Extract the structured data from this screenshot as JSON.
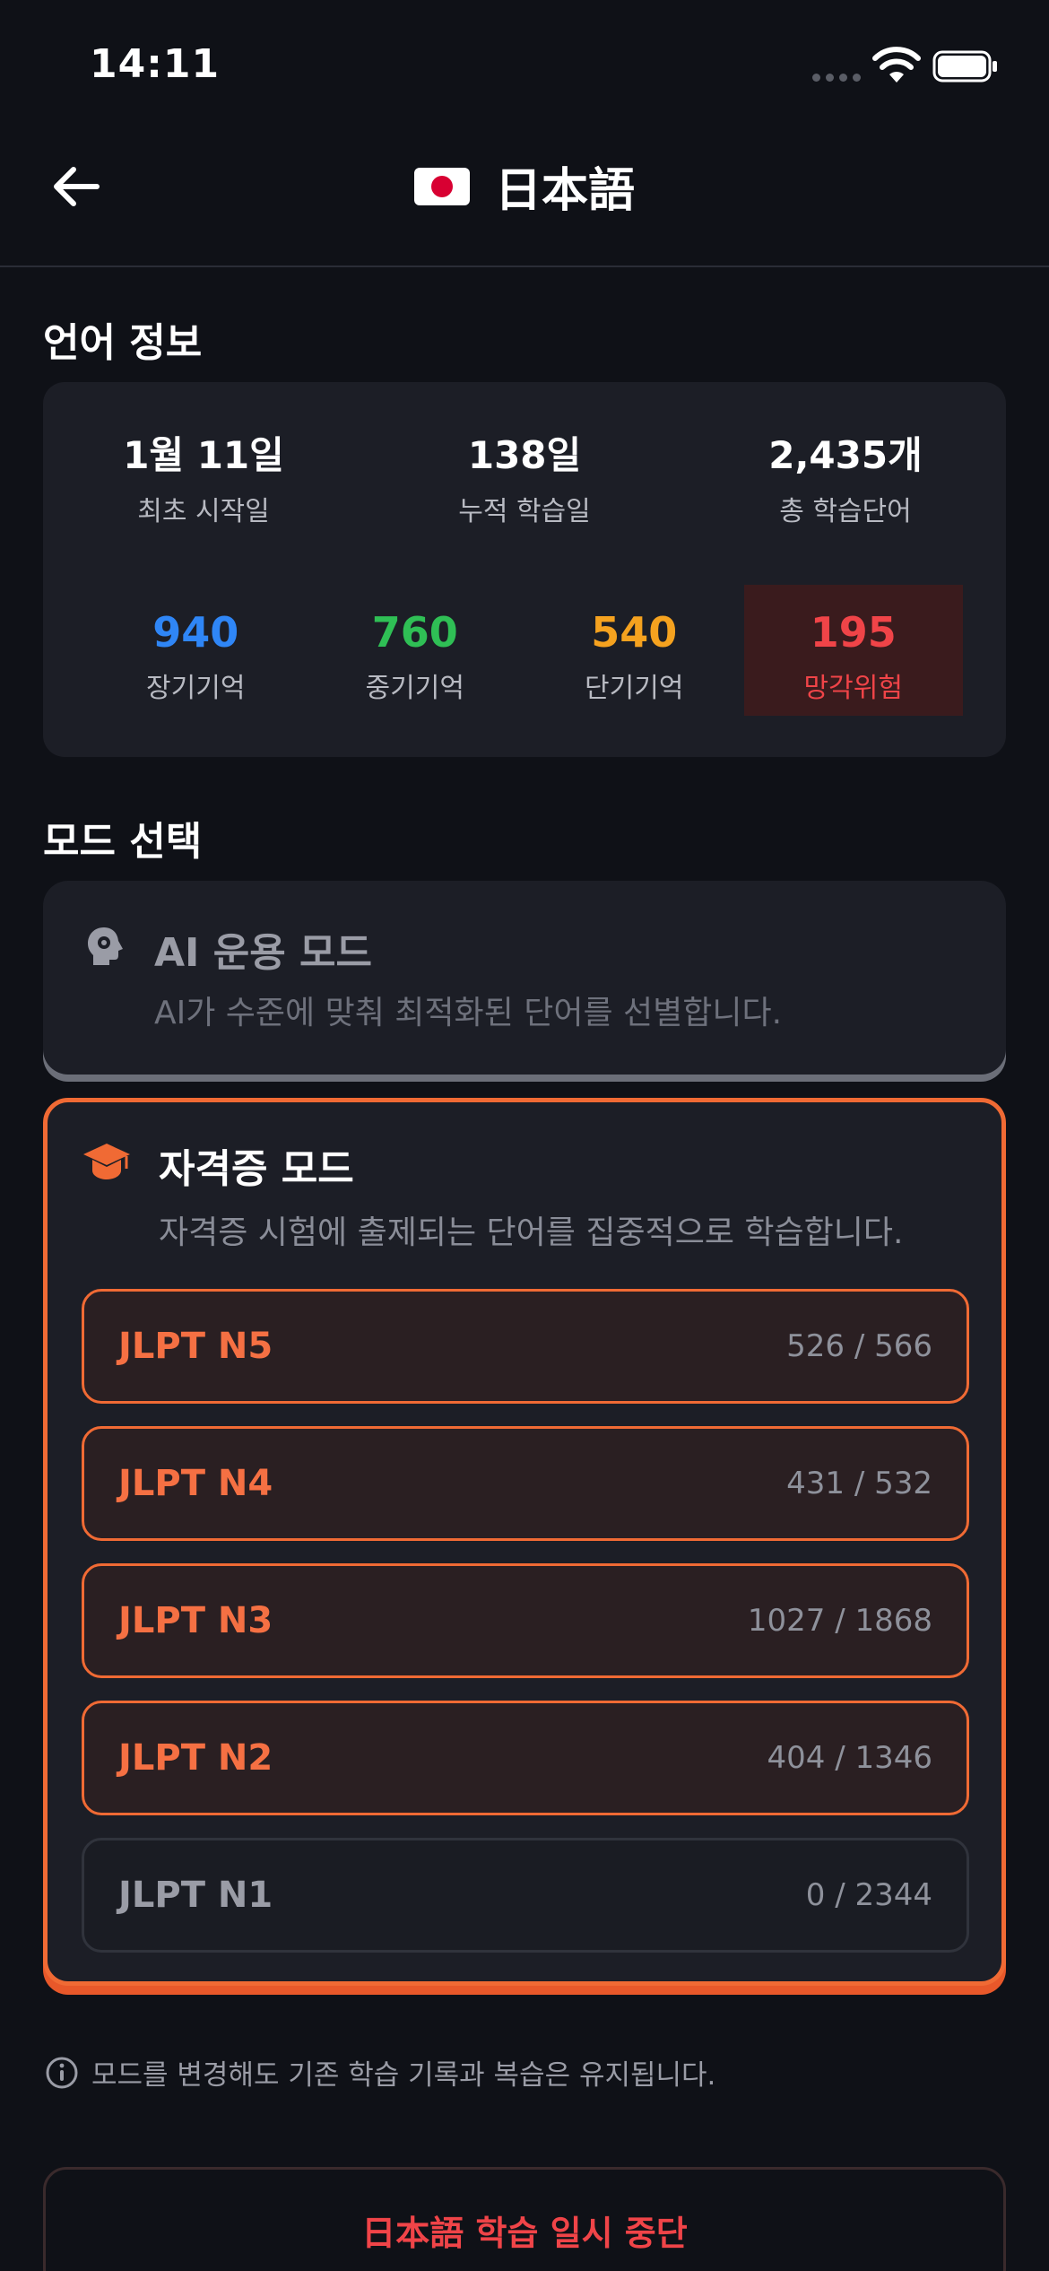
{
  "status_bar": {
    "time": "14:11"
  },
  "header": {
    "title": "日本語",
    "flag_icon": "japan-flag-icon"
  },
  "language_info": {
    "section_title": "언어 정보",
    "stats": [
      {
        "value": "1월 11일",
        "label": "최초 시작일"
      },
      {
        "value": "138일",
        "label": "누적 학습일"
      },
      {
        "value": "2,435개",
        "label": "총 학습단어"
      }
    ],
    "memory": [
      {
        "value": "940",
        "label": "장기기억",
        "color": "#2f86f6"
      },
      {
        "value": "760",
        "label": "중기기억",
        "color": "#2fbf55"
      },
      {
        "value": "540",
        "label": "단기기억",
        "color": "#f5a21f"
      },
      {
        "value": "195",
        "label": "망각위험",
        "color": "#f04448"
      }
    ]
  },
  "mode_select": {
    "section_title": "모드 선택",
    "ai_mode": {
      "title": "AI 운용 모드",
      "description": "AI가 수준에 맞춰 최적화된 단어를 선별합니다."
    },
    "cert_mode": {
      "title": "자격증 모드",
      "description": "자격증 시험에 출제되는 단어를 집중적으로 학습합니다.",
      "levels": [
        {
          "name": "JLPT N5",
          "count": "526 / 566",
          "active": true
        },
        {
          "name": "JLPT N4",
          "count": "431 / 532",
          "active": true
        },
        {
          "name": "JLPT N3",
          "count": "1027 / 1868",
          "active": true
        },
        {
          "name": "JLPT N2",
          "count": "404 / 1346",
          "active": true
        },
        {
          "name": "JLPT N1",
          "count": "0 / 2344",
          "active": false
        }
      ]
    }
  },
  "footer": {
    "notice": "모드를 변경해도 기존 학습 기록과 복습은 유지됩니다.",
    "pause_button": "日本語 학습 일시 중단"
  },
  "colors": {
    "accent": "#f06a34",
    "danger": "#f04448",
    "background": "#0f1117",
    "card": "#1c1e26"
  }
}
